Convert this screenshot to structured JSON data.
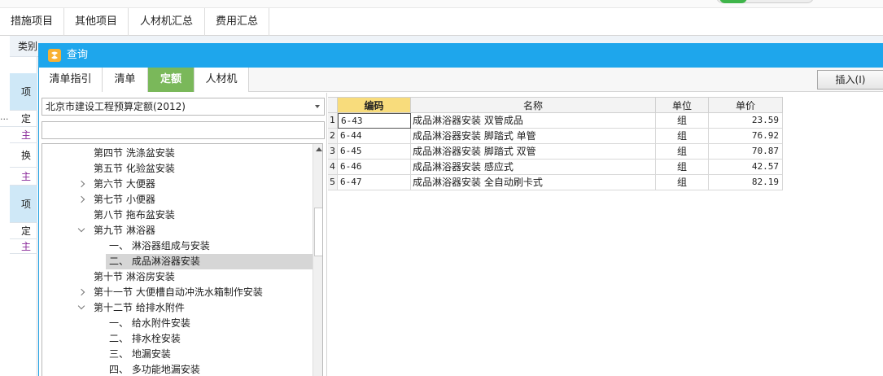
{
  "top_tabs": [
    "措施项目",
    "其他项目",
    "人材机汇总",
    "费用汇总"
  ],
  "background": {
    "header_label": "类别",
    "cells": [
      {
        "text": "项",
        "style": "blue"
      },
      {
        "text": "定",
        "style": ""
      },
      {
        "text": "主",
        "style": "purple"
      },
      {
        "text": "换",
        "style": ""
      },
      {
        "text": "主",
        "style": "purple"
      },
      {
        "text": "项",
        "style": "blue"
      },
      {
        "text": "定",
        "style": ""
      },
      {
        "text": "主",
        "style": "purple"
      }
    ],
    "ellipsis": "..."
  },
  "dialog": {
    "title": "查询",
    "tabs": [
      "清单指引",
      "清单",
      "定额",
      "人材机"
    ],
    "active_tab": "定额",
    "insert_button": "插入(I)",
    "library": "北京市建设工程预算定额(2012)",
    "filter_value": "",
    "tree": [
      {
        "label": "第四节 洗涤盆安装",
        "level": 1,
        "arrow": ""
      },
      {
        "label": "第五节 化验盆安装",
        "level": 1,
        "arrow": ""
      },
      {
        "label": "第六节 大便器",
        "level": 1,
        "arrow": "right"
      },
      {
        "label": "第七节 小便器",
        "level": 1,
        "arrow": "right"
      },
      {
        "label": "第八节 拖布盆安装",
        "level": 1,
        "arrow": ""
      },
      {
        "label": "第九节 淋浴器",
        "level": 1,
        "arrow": "down"
      },
      {
        "label": "一、 淋浴器组成与安装",
        "level": 2,
        "arrow": ""
      },
      {
        "label": "二、 成品淋浴器安装",
        "level": 2,
        "arrow": "",
        "selected": true
      },
      {
        "label": "第十节 淋浴房安装",
        "level": 1,
        "arrow": ""
      },
      {
        "label": "第十一节 大便槽自动冲洗水箱制作安装",
        "level": 1,
        "arrow": "right"
      },
      {
        "label": "第十二节 给排水附件",
        "level": 1,
        "arrow": "down"
      },
      {
        "label": "一、 给水附件安装",
        "level": 2,
        "arrow": ""
      },
      {
        "label": "二、 排水栓安装",
        "level": 2,
        "arrow": ""
      },
      {
        "label": "三、 地漏安装",
        "level": 2,
        "arrow": ""
      },
      {
        "label": "四、 多功能地漏安装",
        "level": 2,
        "arrow": ""
      }
    ],
    "grid": {
      "headers": [
        "",
        "编码",
        "名称",
        "单位",
        "单价"
      ],
      "rows": [
        {
          "no": "1",
          "code": "6-43",
          "name": "成品淋浴器安装 双管成品",
          "unit": "组",
          "price": "23.59"
        },
        {
          "no": "2",
          "code": "6-44",
          "name": "成品淋浴器安装 脚踏式 单管",
          "unit": "组",
          "price": "76.92"
        },
        {
          "no": "3",
          "code": "6-45",
          "name": "成品淋浴器安装 脚踏式 双管",
          "unit": "组",
          "price": "70.87"
        },
        {
          "no": "4",
          "code": "6-46",
          "name": "成品淋浴器安装 感应式",
          "unit": "组",
          "price": "42.57"
        },
        {
          "no": "5",
          "code": "6-47",
          "name": "成品淋浴器安装 全自动刷卡式",
          "unit": "组",
          "price": "82.19"
        }
      ]
    }
  },
  "colors": {
    "title_bar": "#1ea6ec",
    "active_tab": "#7ab85a",
    "header_highlight": "#f8dc7c"
  }
}
